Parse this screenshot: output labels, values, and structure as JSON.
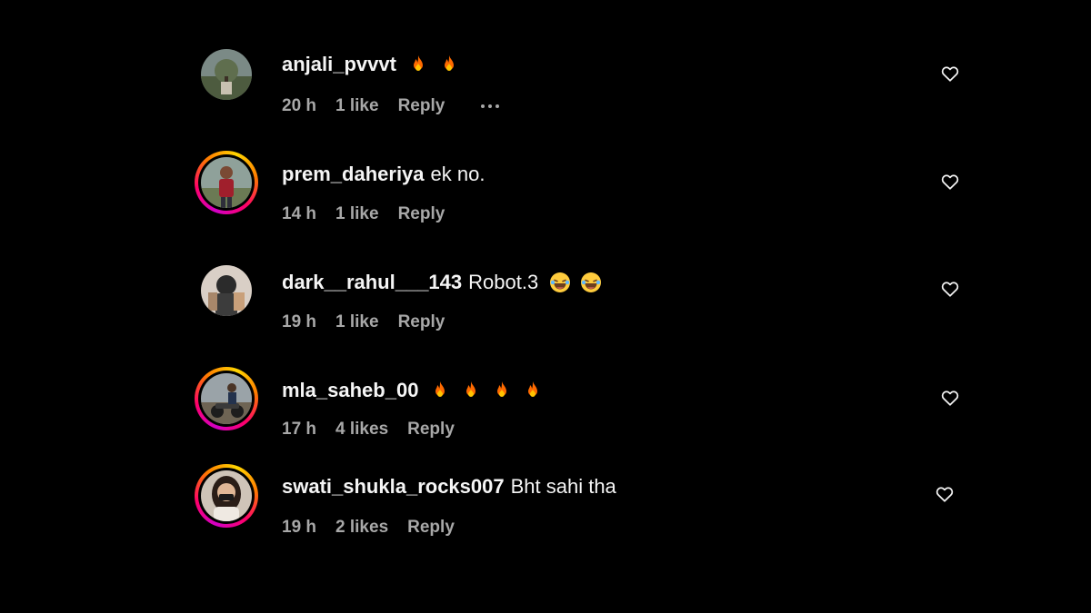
{
  "comments": [
    {
      "username": "anjali_pvvvt",
      "text": "",
      "emoji": [
        "fire",
        "fire"
      ],
      "time": "20 h",
      "likes": "1 like",
      "reply": "Reply",
      "show_more": true,
      "avatar_ring": false
    },
    {
      "username": "prem_daheriya",
      "text": "ek no.",
      "emoji": [],
      "time": "14 h",
      "likes": "1 like",
      "reply": "Reply",
      "show_more": false,
      "avatar_ring": true
    },
    {
      "username": "dark__rahul___143",
      "text": "Robot.3",
      "emoji": [
        "laughing",
        "laughing"
      ],
      "time": "19 h",
      "likes": "1 like",
      "reply": "Reply",
      "show_more": false,
      "avatar_ring": false
    },
    {
      "username": "mla_saheb_00",
      "text": "",
      "emoji": [
        "fire",
        "fire",
        "fire",
        "fire"
      ],
      "time": "17 h",
      "likes": "4 likes",
      "reply": "Reply",
      "show_more": false,
      "avatar_ring": true
    },
    {
      "username": "swati_shukla_rocks007",
      "text": "Bht sahi tha",
      "emoji": [],
      "time": "19 h",
      "likes": "2 likes",
      "reply": "Reply",
      "show_more": false,
      "avatar_ring": true
    }
  ],
  "icons": {
    "like": "heart-outline-icon",
    "more": "more-horizontal-icon"
  },
  "colors": {
    "background": "#000000",
    "primary_text": "#f5f5f5",
    "secondary_text": "#a8a8a8",
    "story_ring": [
      "#d300c5",
      "#ff0069",
      "#ff7a00",
      "#ffd600"
    ]
  }
}
